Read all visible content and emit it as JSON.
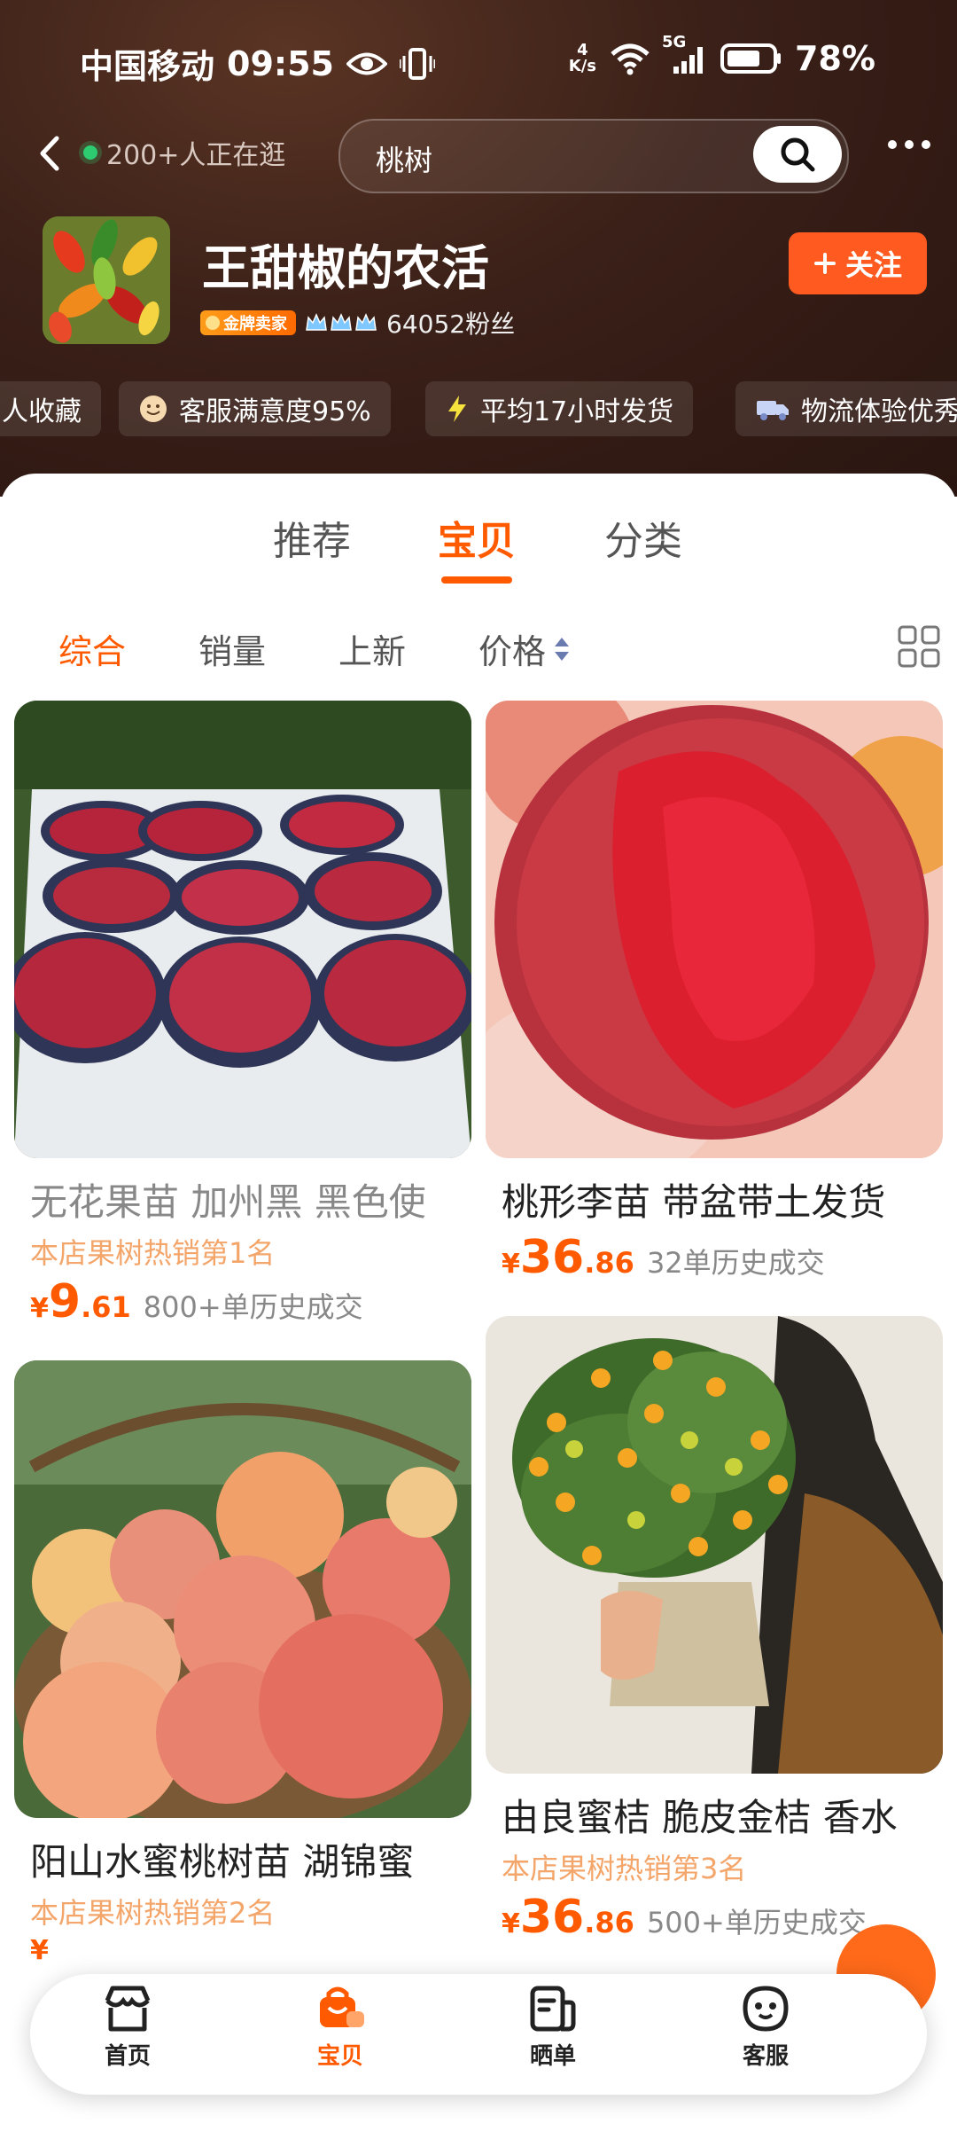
{
  "status_bar": {
    "carrier": "中国移动",
    "time": "09:55",
    "net_speed_top": "4",
    "net_speed_unit": "K/s",
    "signal_label": "5G",
    "battery": "78%"
  },
  "top_nav": {
    "browsing_text": "200+人正在逛",
    "search_value": "桃树"
  },
  "shop": {
    "name": "王甜椒的农活",
    "badge": "金牌卖家",
    "fans": "64052粉丝",
    "follow_label": "关注"
  },
  "highlights": [
    {
      "label": "人收藏",
      "icon": "none"
    },
    {
      "label": "客服满意度95%",
      "icon": "smile-icon"
    },
    {
      "label": "平均17小时发货",
      "icon": "lightning-icon"
    },
    {
      "label": "物流体验优秀",
      "icon": "truck-icon"
    }
  ],
  "tabs": [
    {
      "label": "推荐",
      "active": false
    },
    {
      "label": "宝贝",
      "active": true
    },
    {
      "label": "分类",
      "active": false
    }
  ],
  "sort_options": [
    {
      "label": "综合",
      "active": true
    },
    {
      "label": "销量",
      "active": false
    },
    {
      "label": "上新",
      "active": false
    },
    {
      "label": "价格",
      "active": false
    }
  ],
  "products": [
    {
      "title": "无花果苗 加州黑 黑色使",
      "rank": "本店果树热销第1名",
      "price_symbol": "¥",
      "price_int": "9",
      "price_dec": ".61",
      "sold": "800+单历史成交"
    },
    {
      "title": "桃形李苗 带盆带土发货",
      "rank": "",
      "price_symbol": "¥",
      "price_int": "36",
      "price_dec": ".86",
      "sold": "32单历史成交"
    },
    {
      "title": "阳山水蜜桃树苗 湖锦蜜",
      "rank": "本店果树热销第2名",
      "price_symbol": "¥",
      "price_int": "",
      "price_dec": "",
      "sold": ""
    },
    {
      "title": "由良蜜桔 脆皮金桔 香水",
      "rank": "本店果树热销第3名",
      "price_symbol": "¥",
      "price_int": "36",
      "price_dec": ".86",
      "sold": "500+单历史成交"
    }
  ],
  "bottom_nav": [
    {
      "label": "首页",
      "active": false
    },
    {
      "label": "宝贝",
      "active": true
    },
    {
      "label": "晒单",
      "active": false
    },
    {
      "label": "客服",
      "active": false
    }
  ],
  "colors": {
    "accent": "#ff5a00",
    "header_bg": "#3a2018",
    "rank_text": "#f3a56a",
    "follow_button": "#ff5a1f"
  }
}
